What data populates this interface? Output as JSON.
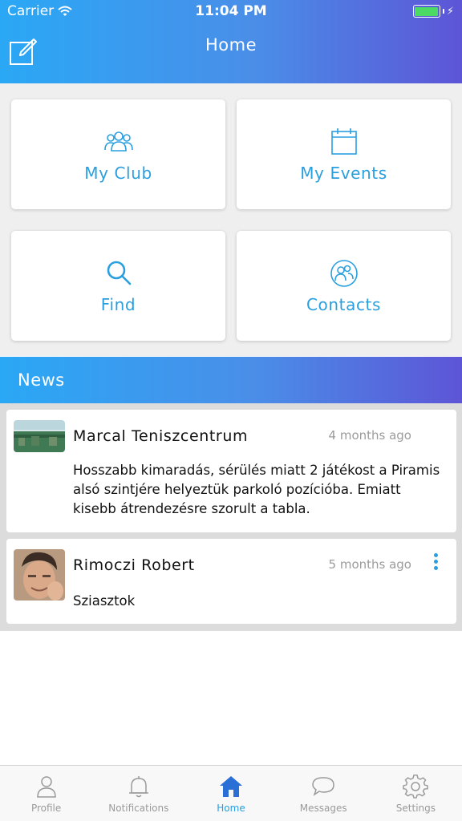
{
  "status_bar": {
    "carrier": "Carrier",
    "time": "11:04 PM"
  },
  "nav": {
    "title": "Home",
    "compose_icon": "compose-icon"
  },
  "tiles": [
    {
      "label": "My Club",
      "icon": "club-group-icon"
    },
    {
      "label": "My Events",
      "icon": "calendar-icon"
    },
    {
      "label": "Find",
      "icon": "search-icon"
    },
    {
      "label": "Contacts",
      "icon": "contacts-icon"
    }
  ],
  "news": {
    "title": "News",
    "items": [
      {
        "author": "Marcal Teniszcentrum",
        "time": "4 months ago",
        "text": "Hosszabb kimaradás, sérülés miatt 2 játékost a Piramis alsó szintjére helyeztük parkoló pozícióba. Emiatt kisebb átrendezésre szorult a tabla."
      },
      {
        "author": "Rimoczi Robert",
        "time": "5 months ago",
        "text": "Sziasztok"
      }
    ]
  },
  "tabbar": {
    "items": [
      {
        "label": "Profile",
        "icon": "profile-icon"
      },
      {
        "label": "Notifications",
        "icon": "bell-icon"
      },
      {
        "label": "Home",
        "icon": "home-icon",
        "active": true
      },
      {
        "label": "Messages",
        "icon": "chat-bubble-icon"
      },
      {
        "label": "Settings",
        "icon": "gear-icon"
      }
    ]
  },
  "colors": {
    "accent": "#2a9fe0",
    "gradient_start": "#2aa8f5",
    "gradient_end": "#5d55d6",
    "battery": "#4cd964"
  }
}
